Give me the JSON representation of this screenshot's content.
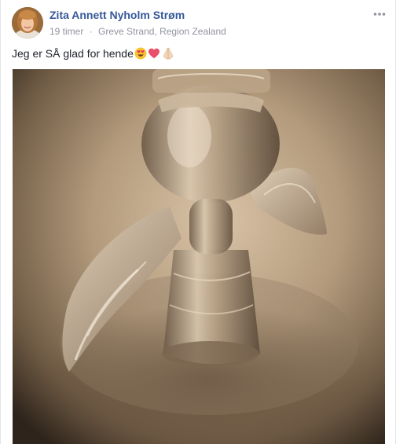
{
  "post": {
    "author": "Zita Annett Nyholm Strøm",
    "time": "19 timer",
    "separator": "·",
    "location": "Greve Strand, Region Zealand",
    "text": "Jeg er SÅ glad for hende",
    "emojis": [
      "heart-eyes-emoji",
      "red-heart-emoji",
      "folded-hands-emoji"
    ],
    "options_icon": "more-options-icon",
    "photo_icon": "glass-angel-figurine"
  }
}
